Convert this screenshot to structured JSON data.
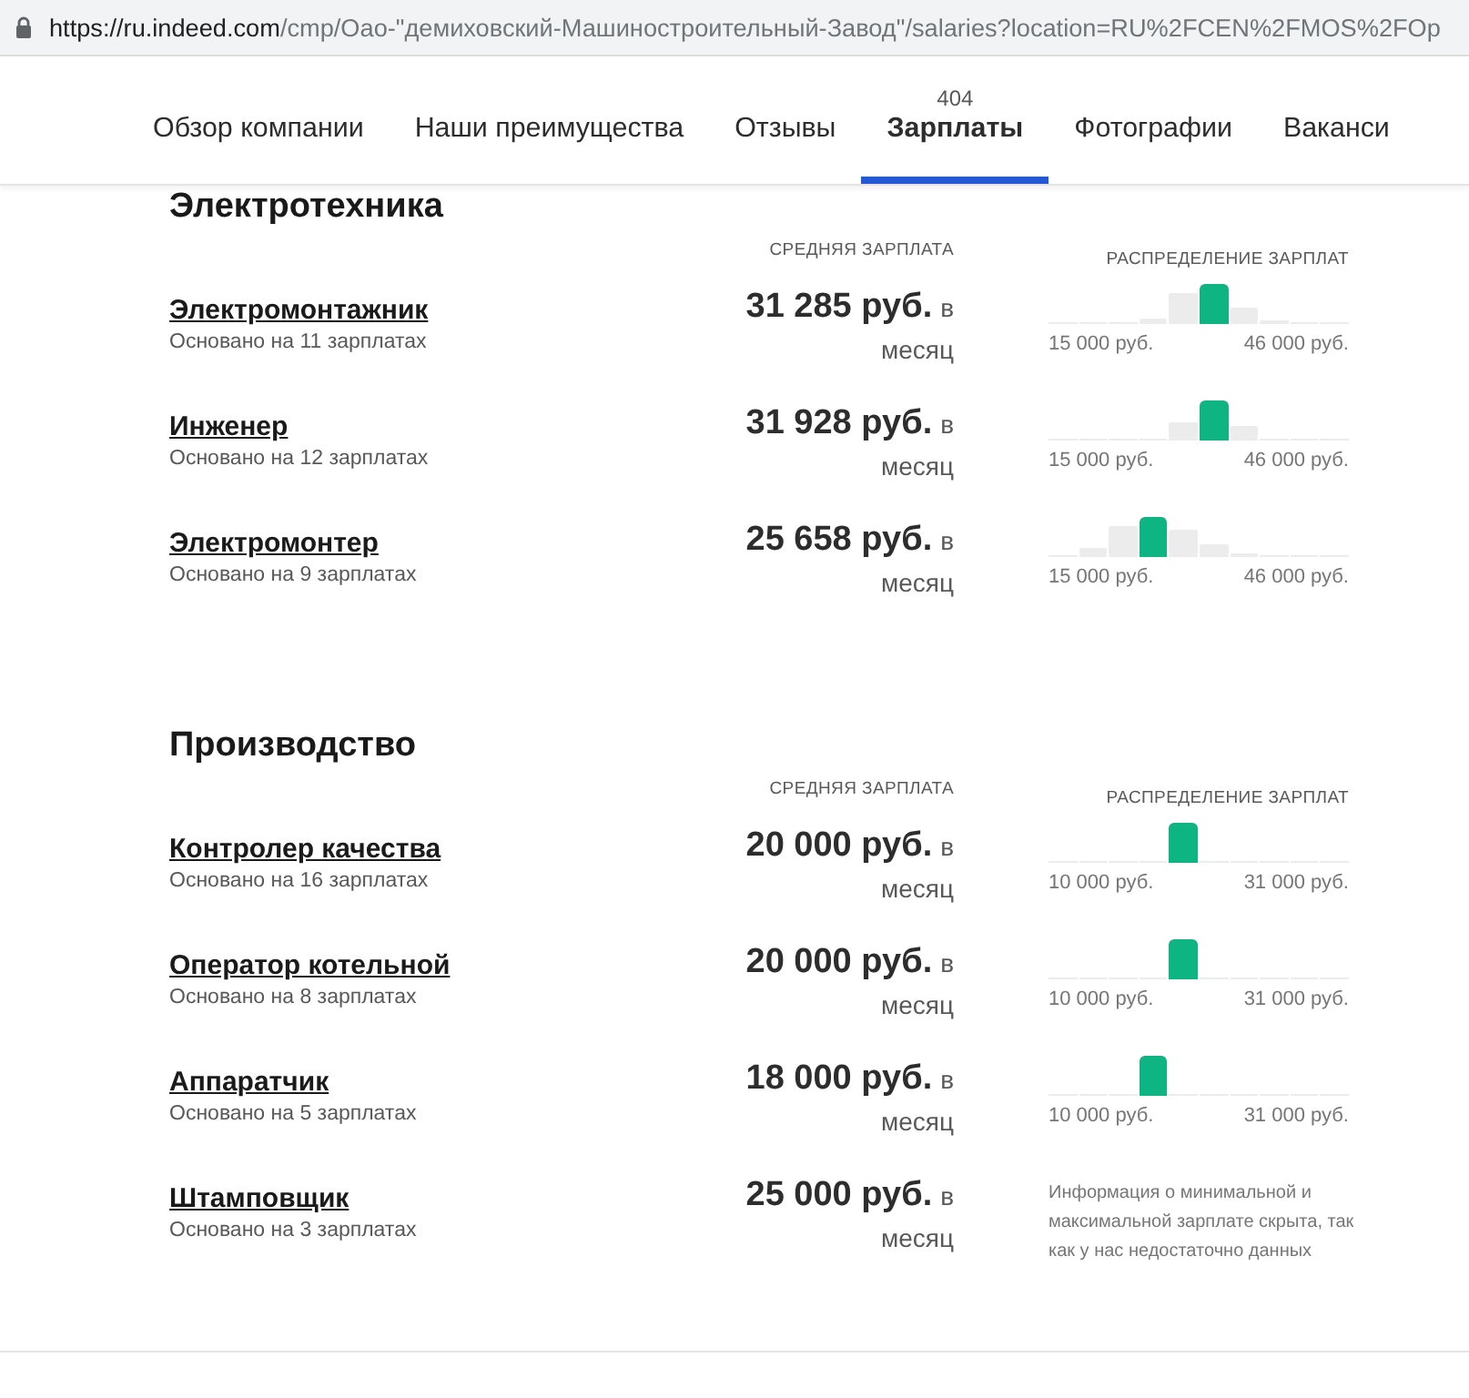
{
  "address_bar": {
    "host": "https://ru.indeed.com",
    "path": "/cmp/Оао-\"демиховский-Машиностроительный-Завод\"/salaries?location=RU%2FCEN%2FMOS%2FOp"
  },
  "tabs": [
    {
      "label": "Обзор компании",
      "selected": false
    },
    {
      "label": "Наши преимущества",
      "selected": false
    },
    {
      "label": "Отзывы",
      "selected": false
    },
    {
      "label": "Зарплаты",
      "count": "404",
      "selected": true
    },
    {
      "label": "Фотографии",
      "selected": false
    },
    {
      "label": "Ваканси",
      "selected": false
    }
  ],
  "sections": [
    {
      "title": "Электротехника",
      "salary_header": "СРЕДНЯЯ ЗАРПЛАТА",
      "distribution_header": "РАСПРЕДЕЛЕНИЕ ЗАРПЛАТ",
      "jobs": [
        {
          "title": "Электромонтажник",
          "basis": "Основано на 11 зарплатах",
          "salary": "31 285 руб.",
          "period": "в месяц",
          "kind": "histogram",
          "min": "15 000 руб.",
          "max": "46 000 руб.",
          "bins": [
            {
              "level": 0,
              "selected": false
            },
            {
              "level": 0,
              "selected": false
            },
            {
              "level": 0,
              "selected": false
            },
            {
              "level": 0.1,
              "selected": false
            },
            {
              "level": 0.75,
              "selected": false
            },
            {
              "level": 1,
              "selected": true
            },
            {
              "level": 0.4,
              "selected": false
            },
            {
              "level": 0.05,
              "selected": false
            },
            {
              "level": 0,
              "selected": false
            },
            {
              "level": 0,
              "selected": false
            }
          ]
        },
        {
          "title": "Инженер",
          "basis": "Основано на 12 зарплатах",
          "salary": "31 928 руб.",
          "period": "в месяц",
          "kind": "histogram",
          "min": "15 000 руб.",
          "max": "46 000 руб.",
          "bins": [
            {
              "level": 0,
              "selected": false
            },
            {
              "level": 0,
              "selected": false
            },
            {
              "level": 0,
              "selected": false
            },
            {
              "level": 0,
              "selected": false
            },
            {
              "level": 0.45,
              "selected": false
            },
            {
              "level": 1,
              "selected": true
            },
            {
              "level": 0.35,
              "selected": false
            },
            {
              "level": 0,
              "selected": false
            },
            {
              "level": 0,
              "selected": false
            },
            {
              "level": 0,
              "selected": false
            }
          ]
        },
        {
          "title": "Электромонтер",
          "basis": "Основано на 9 зарплатах",
          "salary": "25 658 руб.",
          "period": "в месяц",
          "kind": "histogram",
          "min": "15 000 руб.",
          "max": "46 000 руб.",
          "bins": [
            {
              "level": 0,
              "selected": false
            },
            {
              "level": 0.2,
              "selected": false
            },
            {
              "level": 0.75,
              "selected": false
            },
            {
              "level": 1,
              "selected": true
            },
            {
              "level": 0.65,
              "selected": false
            },
            {
              "level": 0.3,
              "selected": false
            },
            {
              "level": 0.05,
              "selected": false
            },
            {
              "level": 0,
              "selected": false
            },
            {
              "level": 0,
              "selected": false
            },
            {
              "level": 0,
              "selected": false
            }
          ]
        }
      ]
    },
    {
      "title": "Производство",
      "salary_header": "СРЕДНЯЯ ЗАРПЛАТА",
      "distribution_header": "РАСПРЕДЕЛЕНИЕ ЗАРПЛАТ",
      "jobs": [
        {
          "title": "Контролер качества",
          "basis": "Основано на 16 зарплатах",
          "salary": "20 000 руб.",
          "period": "в месяц",
          "kind": "histogram",
          "min": "10 000 руб.",
          "max": "31 000 руб.",
          "bins": [
            {
              "level": 0,
              "selected": false
            },
            {
              "level": 0,
              "selected": false
            },
            {
              "level": 0,
              "selected": false
            },
            {
              "level": 0,
              "selected": false
            },
            {
              "level": 1,
              "selected": true
            },
            {
              "level": 0,
              "selected": false
            },
            {
              "level": 0,
              "selected": false
            },
            {
              "level": 0,
              "selected": false
            },
            {
              "level": 0,
              "selected": false
            },
            {
              "level": 0,
              "selected": false
            }
          ]
        },
        {
          "title": "Оператор котельной",
          "basis": "Основано на 8 зарплатах",
          "salary": "20 000 руб.",
          "period": "в месяц",
          "kind": "histogram",
          "min": "10 000 руб.",
          "max": "31 000 руб.",
          "bins": [
            {
              "level": 0,
              "selected": false
            },
            {
              "level": 0,
              "selected": false
            },
            {
              "level": 0,
              "selected": false
            },
            {
              "level": 0,
              "selected": false
            },
            {
              "level": 1,
              "selected": true
            },
            {
              "level": 0,
              "selected": false
            },
            {
              "level": 0,
              "selected": false
            },
            {
              "level": 0,
              "selected": false
            },
            {
              "level": 0,
              "selected": false
            },
            {
              "level": 0,
              "selected": false
            }
          ]
        },
        {
          "title": "Аппаратчик",
          "basis": "Основано на 5 зарплатах",
          "salary": "18 000 руб.",
          "period": "в месяц",
          "kind": "histogram",
          "min": "10 000 руб.",
          "max": "31 000 руб.",
          "bins": [
            {
              "level": 0,
              "selected": false
            },
            {
              "level": 0,
              "selected": false
            },
            {
              "level": 0,
              "selected": false
            },
            {
              "level": 1,
              "selected": true
            },
            {
              "level": 0,
              "selected": false
            },
            {
              "level": 0,
              "selected": false
            },
            {
              "level": 0,
              "selected": false
            },
            {
              "level": 0,
              "selected": false
            },
            {
              "level": 0,
              "selected": false
            },
            {
              "level": 0,
              "selected": false
            }
          ]
        },
        {
          "title": "Штамповщик",
          "basis": "Основано на 3 зарплатах",
          "salary": "25 000 руб.",
          "period": "в месяц",
          "kind": "note",
          "note": "Информация о минимальной и максимальной зарплате скрыта, так как у нас недостаточно данных"
        }
      ]
    }
  ]
}
